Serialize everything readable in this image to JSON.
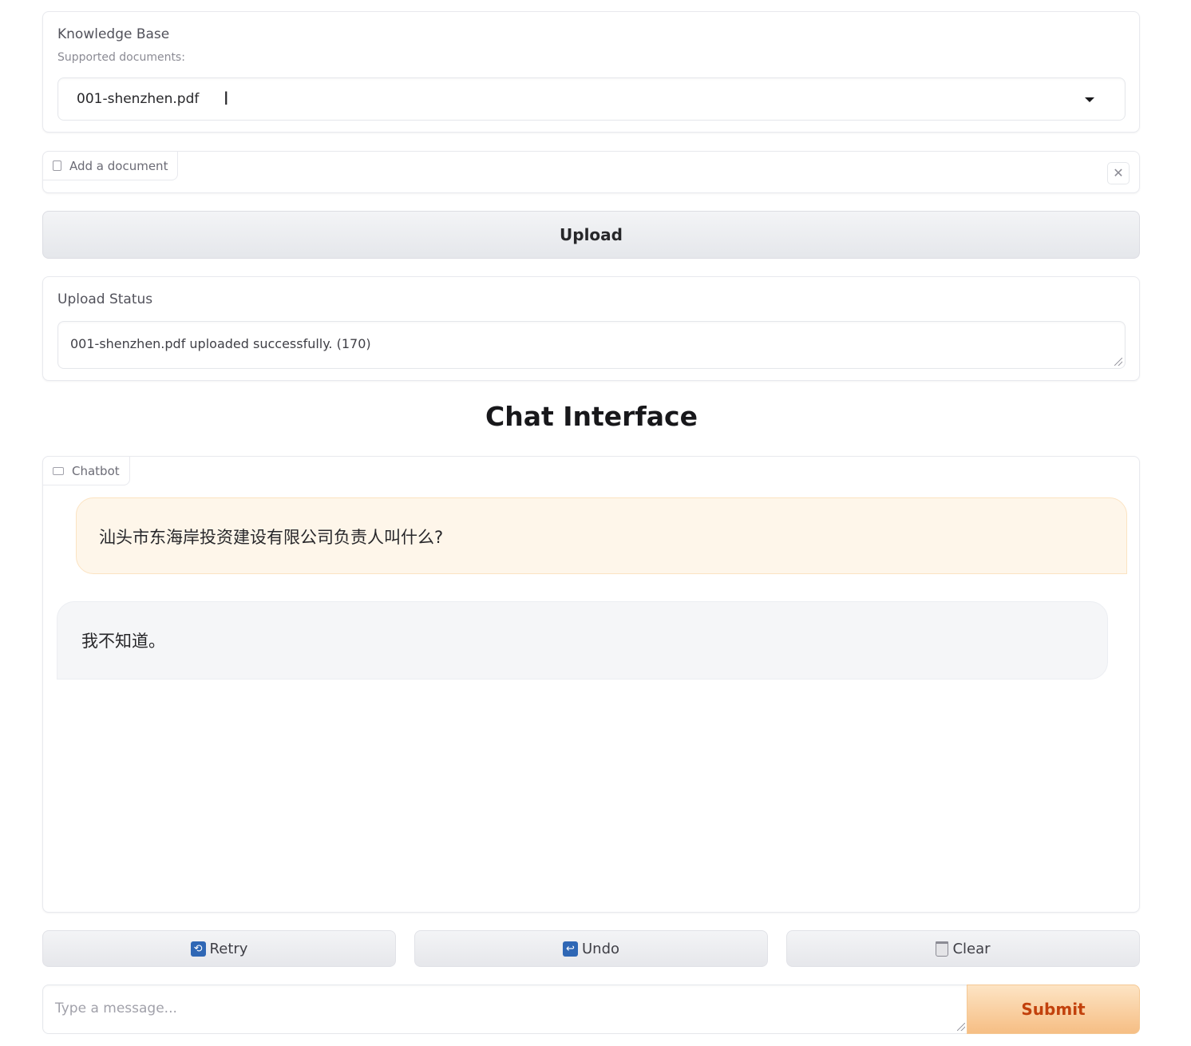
{
  "knowledge_base": {
    "label": "Knowledge Base",
    "sublabel": "Supported documents:",
    "selected": "001-shenzhen.pdf"
  },
  "add_document": {
    "label": "Add a document"
  },
  "upload": {
    "button_label": "Upload"
  },
  "upload_status": {
    "label": "Upload Status",
    "value": "001-shenzhen.pdf uploaded successfully. (170)"
  },
  "title": "Chat Interface",
  "chatbot": {
    "label": "Chatbot",
    "messages": [
      {
        "role": "user",
        "text": "汕头市东海岸投资建设有限公司负责人叫什么?"
      },
      {
        "role": "bot",
        "text": "我不知道。"
      }
    ]
  },
  "actions": {
    "retry": "Retry",
    "undo": "Undo",
    "clear": "Clear"
  },
  "input": {
    "placeholder": "Type a message...",
    "submit_label": "Submit"
  },
  "colors": {
    "accent": "#f6be84",
    "submit_text": "#c2410c",
    "user_bubble": "#fef6ea",
    "bot_bubble": "#f5f6f8",
    "action_icon": "#2f67b5"
  },
  "icons": [
    "file-icon",
    "close-icon",
    "chat-icon",
    "retry-icon",
    "undo-icon",
    "trash-icon",
    "caret-down-icon",
    "text-cursor-icon",
    "resize-handle-icon"
  ]
}
